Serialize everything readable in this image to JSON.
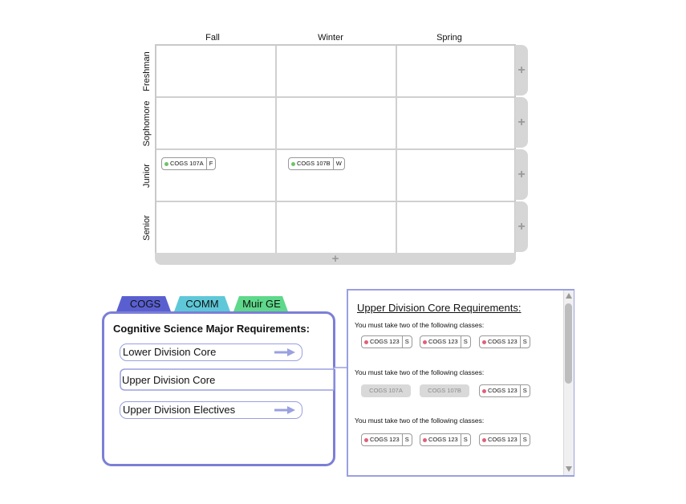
{
  "planner": {
    "columns": [
      "Fall",
      "Winter",
      "Spring"
    ],
    "rows": [
      "Freshman",
      "Sophomore",
      "Junior",
      "Senior"
    ],
    "add_symbol": "+",
    "placed_courses": [
      {
        "name": "COGS 107A",
        "term": "F",
        "status_color": "#6fc36a"
      },
      {
        "name": "COGS 107B",
        "term": "W",
        "status_color": "#6fc36a"
      }
    ]
  },
  "tabs": [
    {
      "label": "COGS",
      "color": "#5a5fd0",
      "active": true
    },
    {
      "label": "COMM",
      "color": "#5ec8d8",
      "active": false
    },
    {
      "label": "Muir GE",
      "color": "#5ed88a",
      "active": false
    }
  ],
  "requirements": {
    "title": "Cognitive Science Major Requirements:",
    "categories": [
      {
        "label": "Lower Division Core",
        "has_arrow": true
      },
      {
        "label": "Upper Division Core",
        "has_arrow": false
      },
      {
        "label": "Upper Division Electives",
        "has_arrow": true
      }
    ]
  },
  "detail": {
    "title": "Upper Division Core Requirements:",
    "groups": [
      {
        "instruction": "You must take two of the following classes:",
        "courses": [
          {
            "name": "COGS 123",
            "term": "S",
            "status_color": "#e0607a"
          },
          {
            "name": "COGS 123",
            "term": "S",
            "status_color": "#e0607a"
          },
          {
            "name": "COGS 123",
            "term": "S",
            "status_color": "#e0607a"
          }
        ]
      },
      {
        "instruction": "You must take two of the following classes:",
        "courses": [
          {
            "name": "COGS 107A",
            "disabled": true
          },
          {
            "name": "COGS 107B",
            "disabled": true
          },
          {
            "name": "COGS 123",
            "term": "S",
            "status_color": "#e0607a"
          }
        ]
      },
      {
        "instruction": "You must take two of the following classes:",
        "courses": [
          {
            "name": "COGS 123",
            "term": "S",
            "status_color": "#e0607a"
          },
          {
            "name": "COGS 123",
            "term": "S",
            "status_color": "#e0607a"
          },
          {
            "name": "COGS 123",
            "term": "S",
            "status_color": "#e0607a"
          }
        ]
      }
    ]
  },
  "colors": {
    "accent": "#7c7fd6",
    "grid_border": "#c9c9c9",
    "add_bar": "#d6d6d6"
  }
}
